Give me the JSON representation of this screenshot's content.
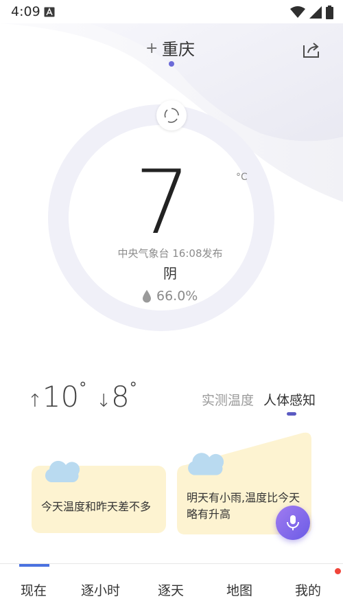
{
  "status_bar": {
    "time": "4:09",
    "icons": [
      "a-notification-icon",
      "wifi-icon",
      "signal-icon",
      "battery-icon"
    ]
  },
  "header": {
    "add_label": "+",
    "city": "重庆",
    "share_icon": "share-icon"
  },
  "current": {
    "temperature": "7",
    "unit": "°C",
    "publish_info": "中央气象台 16:08发布",
    "condition": "阴",
    "humidity": "66.0%",
    "refresh_icon": "refresh-icon"
  },
  "range": {
    "high_arrow": "↑",
    "high": "10",
    "low_arrow": "↓",
    "low": "8",
    "degree": "°"
  },
  "temp_modes": {
    "tabs": [
      "实测温度",
      "人体感知"
    ],
    "active_index": 1
  },
  "cards": {
    "left": "今天温度和昨天差不多",
    "right_line1": "明天有小雨,温度比今天",
    "right_line2": "略有升高"
  },
  "bottom_nav": {
    "items": [
      "现在",
      "逐小时",
      "逐天",
      "地图",
      "我的"
    ],
    "active_index": 0
  },
  "colors": {
    "accent": "#5b5bc2",
    "nav_indicator": "#4a72e0",
    "card_bg": "#fdf3d1",
    "cloud": "#b9daf0",
    "badge": "#f0453a",
    "mic_gradient_start": "#a07bf0",
    "mic_gradient_end": "#6b5ce6"
  }
}
